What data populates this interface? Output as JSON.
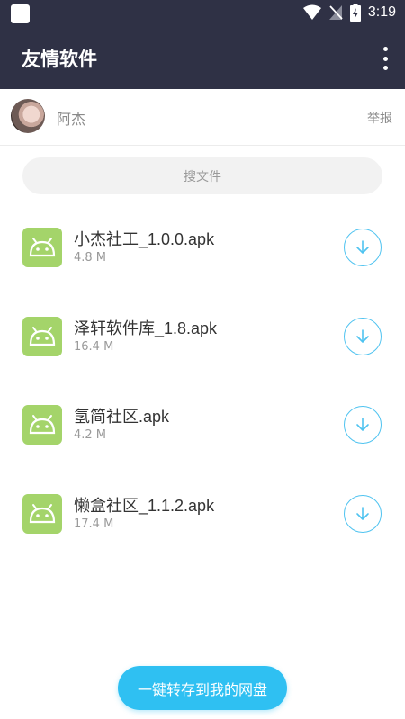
{
  "status_bar": {
    "time": "3:19",
    "icons": [
      "app-notification-icon",
      "wifi-icon",
      "no-signal-icon",
      "battery-charging-icon"
    ]
  },
  "app_bar": {
    "title": "友情软件",
    "menu_icon": "more-vert-icon"
  },
  "user": {
    "name": "阿杰",
    "report_label": "举报"
  },
  "search": {
    "label": "搜文件"
  },
  "files": [
    {
      "name": "小杰社工_1.0.0.apk",
      "size": "4.8 M"
    },
    {
      "name": "泽轩软件库_1.8.apk",
      "size": "16.4 M"
    },
    {
      "name": "氢简社区.apk",
      "size": "4.2 M"
    },
    {
      "name": "懒盒社区_1.1.2.apk",
      "size": "17.4 M"
    }
  ],
  "actions": {
    "save_to_drive_label": "一键转存到我的网盘"
  },
  "colors": {
    "header_bg": "#2f3145",
    "accent": "#2fc0f2",
    "apk_icon_bg": "#a4d46a"
  }
}
